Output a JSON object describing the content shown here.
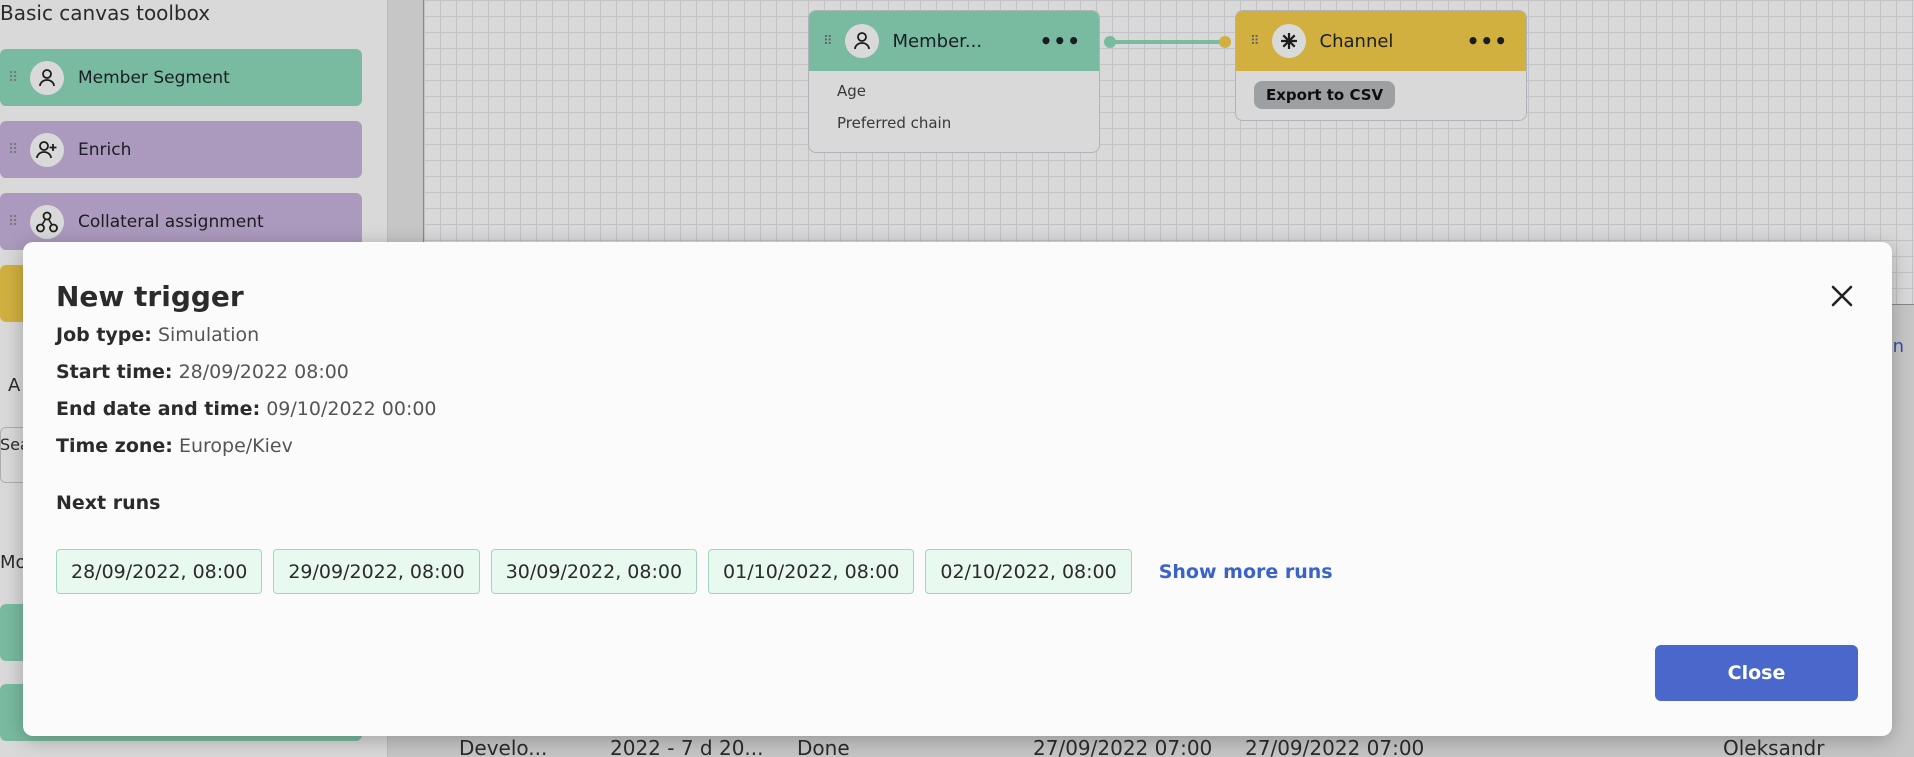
{
  "toolbox": {
    "title": "Basic canvas toolbox",
    "items": [
      {
        "label": "Member Segment",
        "icon": "person-icon",
        "color": "#8fdcbd"
      },
      {
        "label": "Enrich",
        "icon": "person-add-icon",
        "color": "#c9b6de"
      },
      {
        "label": "Collateral assignment",
        "icon": "share-nodes-icon",
        "color": "#c9b6de"
      }
    ],
    "fragments": [
      "A",
      "Sea",
      "Mo"
    ]
  },
  "canvas": {
    "member_node": {
      "title": "Member...",
      "rows": [
        "Age",
        "Preferred chain"
      ]
    },
    "channel_node": {
      "title": "Channel",
      "tag": "Export to CSV"
    }
  },
  "background_table": {
    "row": [
      "Develo...",
      "2022 - 7 d 20...",
      "Done",
      "27/09/2022 07:00",
      "27/09/2022 07:00",
      "Oleksandr"
    ]
  },
  "modal": {
    "title": "New trigger",
    "job_type_label": "Job type:",
    "job_type_value": "Simulation",
    "start_label": "Start time:",
    "start_value": "28/09/2022 08:00",
    "end_label": "End date and time:",
    "end_value": "09/10/2022 00:00",
    "tz_label": "Time zone:",
    "tz_value": "Europe/Kiev",
    "next_runs_label": "Next runs",
    "runs": [
      "28/09/2022, 08:00",
      "29/09/2022, 08:00",
      "30/09/2022, 08:00",
      "01/10/2022, 08:00",
      "02/10/2022, 08:00"
    ],
    "show_more": "Show more runs",
    "close_label": "Close"
  },
  "colors": {
    "accent": "#4a68cc",
    "green": "#8fdcbd",
    "purple": "#c9b6de",
    "yellow": "#f6cf4b"
  }
}
